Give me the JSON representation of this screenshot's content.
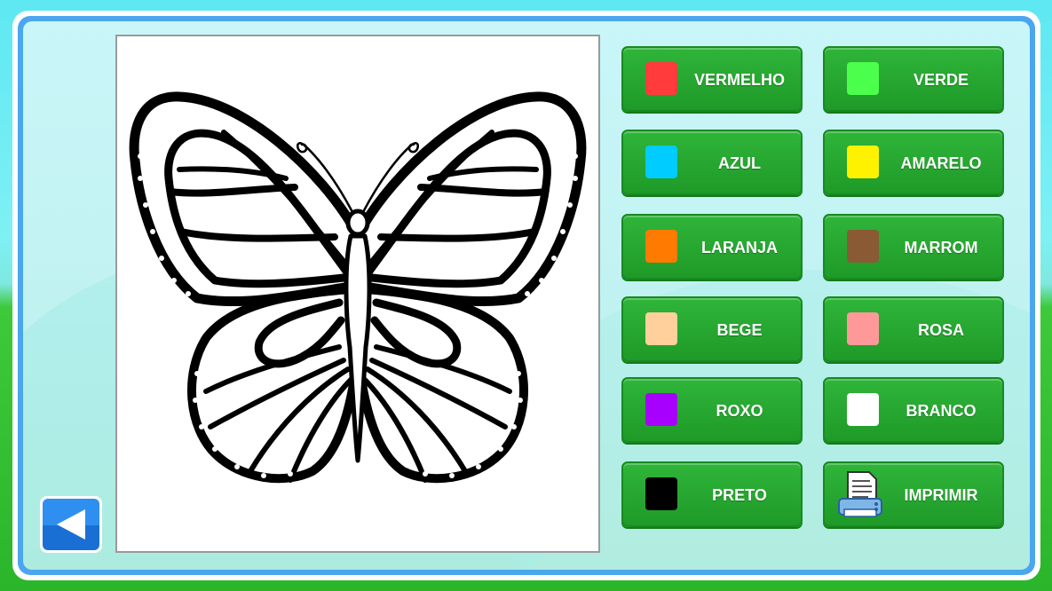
{
  "buttons": [
    {
      "label": "VERMELHO",
      "color": "#ff3b3b",
      "icon": "swatch"
    },
    {
      "label": "VERDE",
      "color": "#4cff4c",
      "icon": "swatch"
    },
    {
      "label": "AZUL",
      "color": "#00ccff",
      "icon": "swatch"
    },
    {
      "label": "AMARELO",
      "color": "#fff200",
      "icon": "swatch"
    },
    {
      "label": "LARANJA",
      "color": "#ff7a00",
      "icon": "swatch"
    },
    {
      "label": "MARROM",
      "color": "#8a5a35",
      "icon": "swatch"
    },
    {
      "label": "BEGE",
      "color": "#ffd09b",
      "icon": "swatch"
    },
    {
      "label": "ROSA",
      "color": "#ff9999",
      "icon": "swatch"
    },
    {
      "label": "ROXO",
      "color": "#a800ff",
      "icon": "swatch"
    },
    {
      "label": "BRANCO",
      "color": "#ffffff",
      "icon": "swatch"
    },
    {
      "label": "PRETO",
      "color": "#000000",
      "icon": "swatch"
    },
    {
      "label": "IMPRIMIR",
      "color": "",
      "icon": "printer-icon"
    }
  ],
  "canvas": {
    "image": "butterfly-coloring-page"
  },
  "back_button": {
    "icon": "back-arrow-icon",
    "color": "#2e8ff0"
  }
}
